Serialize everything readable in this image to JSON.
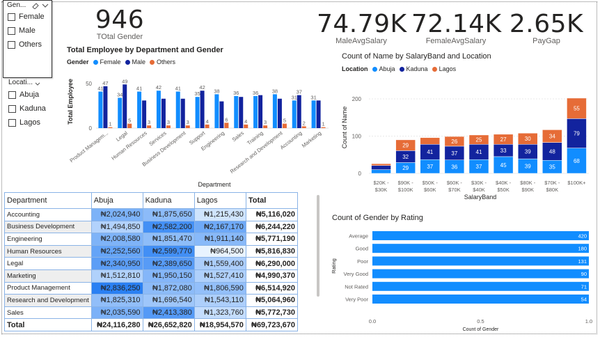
{
  "slicers": {
    "gender": {
      "title": "Gen...",
      "items": [
        "Female",
        "Male",
        "Others"
      ]
    },
    "location": {
      "title": "Locati...",
      "items": [
        "Abuja",
        "Kaduna",
        "Lagos"
      ]
    }
  },
  "kpis": {
    "total_gender": {
      "value": "946",
      "label": "TOtal Gender"
    },
    "male_avg": {
      "value": "74.79K",
      "label": "MaleAvgSalary"
    },
    "female_avg": {
      "value": "72.14K",
      "label": "FemaleAvgSalary"
    },
    "paygap": {
      "value": "2.65K",
      "label": "PayGap"
    }
  },
  "colors": {
    "blue": "#118dff",
    "navy": "#12239e",
    "orange": "#e66c37"
  },
  "chart_data": [
    {
      "type": "bar",
      "title": "Total Employee by Department and Gender",
      "legend_title": "Gender",
      "xlabel": "Department",
      "ylabel": "Total Employee",
      "yticks": [
        "0",
        "50"
      ],
      "ylim": [
        0,
        50
      ],
      "categories": [
        "Product Managem...",
        "Legal",
        "Human Resources",
        "Services",
        "Business Development",
        "Support",
        "Engineering",
        "Sales",
        "Training",
        "Research and Development",
        "Accounting",
        "Marketing"
      ],
      "series": [
        {
          "name": "Female",
          "values": [
            41,
            34,
            41,
            42,
            41,
            35,
            38,
            36,
            36,
            38,
            31,
            31
          ],
          "labels": [
            "41",
            "34",
            "41",
            "42",
            "41",
            "35",
            "38",
            "36",
            "36",
            "38",
            "31",
            "31"
          ]
        },
        {
          "name": "Male",
          "values": [
            47,
            49,
            31,
            33,
            33,
            42,
            30,
            35,
            37,
            33,
            37,
            31
          ],
          "labels": [
            "47",
            "49",
            "",
            "",
            "",
            "42",
            "",
            "",
            "",
            "",
            "37",
            ""
          ]
        },
        {
          "name": "Others",
          "values": [
            1,
            5,
            3,
            3,
            3,
            4,
            6,
            4,
            3,
            5,
            2,
            1
          ],
          "labels": [
            "1",
            "5",
            "3",
            "3",
            "3",
            "4",
            "6",
            "4",
            "3",
            "5",
            "2",
            "1"
          ]
        }
      ]
    },
    {
      "type": "bar",
      "stacked": true,
      "title": "Count of Name by SalaryBand and Location",
      "legend_title": "Location",
      "xlabel": "SalaryBand",
      "ylabel": "Count of Name",
      "yticks": [
        "0",
        "100",
        "200"
      ],
      "ylim": [
        0,
        200
      ],
      "categories": [
        [
          "$20K -",
          "$30K"
        ],
        [
          "$90K -",
          "$100K"
        ],
        [
          "$50K -",
          "$60K"
        ],
        [
          "$60K -",
          "$70K"
        ],
        [
          "$30K -",
          "$40K"
        ],
        [
          "$40K -",
          "$50K"
        ],
        [
          "$80K -",
          "$90K"
        ],
        [
          "$70K -",
          "$80K"
        ],
        [
          "$100K+"
        ]
      ],
      "series": [
        {
          "name": "Abuja",
          "values": [
            10,
            29,
            37,
            36,
            37,
            45,
            39,
            35,
            68
          ],
          "labels": [
            "",
            "29",
            "37",
            "36",
            "37",
            "45",
            "39",
            "35",
            "68"
          ]
        },
        {
          "name": "Kaduna",
          "values": [
            11,
            32,
            41,
            37,
            41,
            33,
            39,
            48,
            79
          ],
          "labels": [
            "",
            "32",
            "41",
            "37",
            "41",
            "33",
            "39",
            "48",
            "79"
          ]
        },
        {
          "name": "Lagos",
          "values": [
            5,
            29,
            18,
            26,
            25,
            27,
            30,
            34,
            55
          ],
          "labels": [
            "",
            "29",
            "",
            "26",
            "25",
            "27",
            "30",
            "34",
            "55"
          ]
        }
      ]
    },
    {
      "type": "bar",
      "orientation": "horizontal",
      "title": "Count of Gender by Rating",
      "xlabel": "Count of Gender",
      "ylabel": "Rating",
      "xticks": [
        "0.0",
        "0.5",
        "1.0"
      ],
      "categories": [
        "Average",
        "Good",
        "Poor",
        "Very Good",
        "Not Rated",
        "Very Poor"
      ],
      "values": [
        420,
        180,
        131,
        90,
        71,
        54
      ]
    }
  ],
  "table": {
    "headers": [
      "Department",
      "Abuja",
      "Kaduna",
      "Lagos",
      "Total"
    ],
    "rows": [
      {
        "name": "Accounting",
        "values": [
          "₦2,024,940",
          "₦1,875,650",
          "₦1,215,430",
          "₦5,116,020"
        ],
        "raw": [
          2024940,
          1875650,
          1215430
        ]
      },
      {
        "name": "Business Development",
        "values": [
          "₦1,494,850",
          "₦2,582,200",
          "₦2,167,170",
          "₦6,244,220"
        ],
        "raw": [
          1494850,
          2582200,
          2167170
        ]
      },
      {
        "name": "Engineering",
        "values": [
          "₦2,008,580",
          "₦1,851,470",
          "₦1,911,140",
          "₦5,771,190"
        ],
        "raw": [
          2008580,
          1851470,
          1911140
        ]
      },
      {
        "name": "Human Resources",
        "values": [
          "₦2,252,560",
          "₦2,599,770",
          "₦964,500",
          "₦5,816,830"
        ],
        "raw": [
          2252560,
          2599770,
          964500
        ]
      },
      {
        "name": "Legal",
        "values": [
          "₦2,340,950",
          "₦2,389,650",
          "₦1,559,400",
          "₦6,290,000"
        ],
        "raw": [
          2340950,
          2389650,
          1559400
        ]
      },
      {
        "name": "Marketing",
        "values": [
          "₦1,512,810",
          "₦1,950,150",
          "₦1,527,410",
          "₦4,990,370"
        ],
        "raw": [
          1512810,
          1950150,
          1527410
        ]
      },
      {
        "name": "Product Management",
        "values": [
          "₦2,836,250",
          "₦1,872,080",
          "₦1,806,590",
          "₦6,514,920"
        ],
        "raw": [
          2836250,
          1872080,
          1806590
        ]
      },
      {
        "name": "Research and Development",
        "values": [
          "₦1,825,310",
          "₦1,696,540",
          "₦1,543,110",
          "₦5,064,960"
        ],
        "raw": [
          1825310,
          1696540,
          1543110
        ]
      },
      {
        "name": "Sales",
        "values": [
          "₦2,035,590",
          "₦2,413,380",
          "₦1,323,760",
          "₦5,772,730"
        ],
        "raw": [
          2035590,
          2413380,
          1323760
        ]
      }
    ],
    "total": {
      "name": "Total",
      "values": [
        "₦24,116,280",
        "₦26,652,820",
        "₦18,954,570",
        "₦69,723,670"
      ]
    }
  }
}
